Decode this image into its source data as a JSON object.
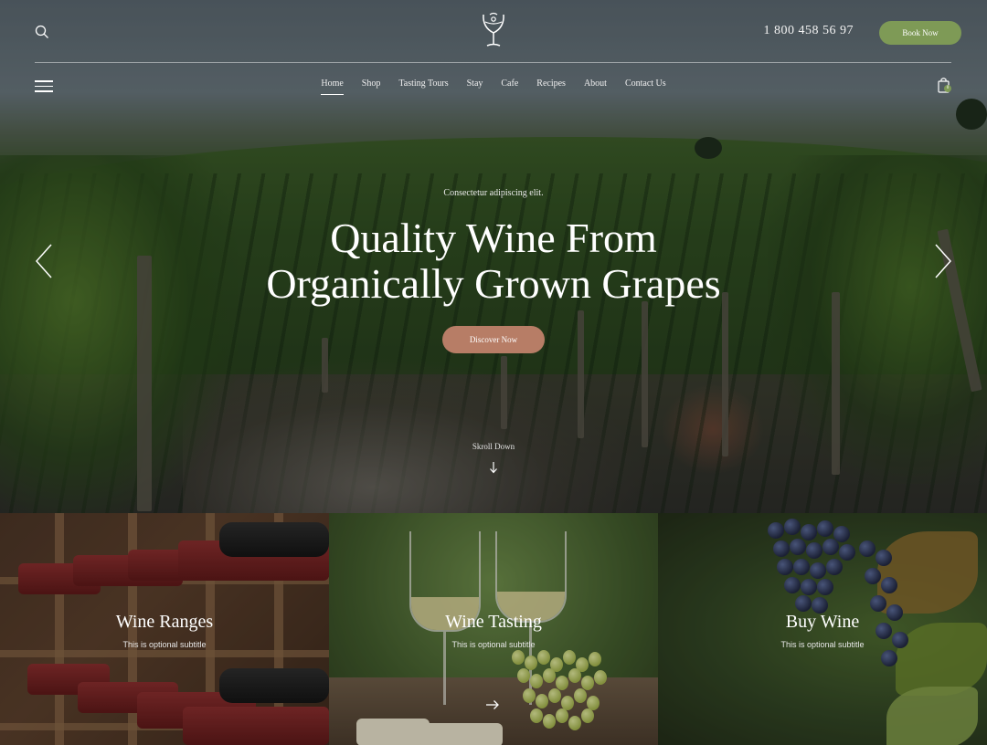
{
  "header": {
    "phone": "1 800 458 56 97",
    "book_label": "Book Now",
    "cart_count": "0"
  },
  "nav": {
    "items": [
      {
        "label": "Home",
        "active": true
      },
      {
        "label": "Shop"
      },
      {
        "label": "Tasting Tours"
      },
      {
        "label": "Stay"
      },
      {
        "label": "Cafe"
      },
      {
        "label": "Recipes"
      },
      {
        "label": "About"
      },
      {
        "label": "Contact Us"
      }
    ]
  },
  "hero": {
    "eyebrow": "Consectetur adipiscing elit.",
    "headline_line1": "Quality Wine From",
    "headline_line2": "Organically Grown Grapes",
    "cta_label": "Discover Now",
    "scroll_label": "Skroll Down"
  },
  "cards": [
    {
      "title": "Wine Ranges",
      "subtitle": "This is optional subtitle"
    },
    {
      "title": "Wine Tasting",
      "subtitle": "This is optional subtitle"
    },
    {
      "title": "Buy Wine",
      "subtitle": "This is optional subtitle"
    }
  ],
  "colors": {
    "accent_green": "#7e9a56",
    "accent_terracotta": "#b77d66"
  },
  "icons": [
    "search-icon",
    "wine-glass-logo-icon",
    "menu-icon",
    "cart-icon",
    "arrow-left-icon",
    "arrow-right-icon",
    "arrow-down-icon",
    "arrow-right-small-icon"
  ]
}
